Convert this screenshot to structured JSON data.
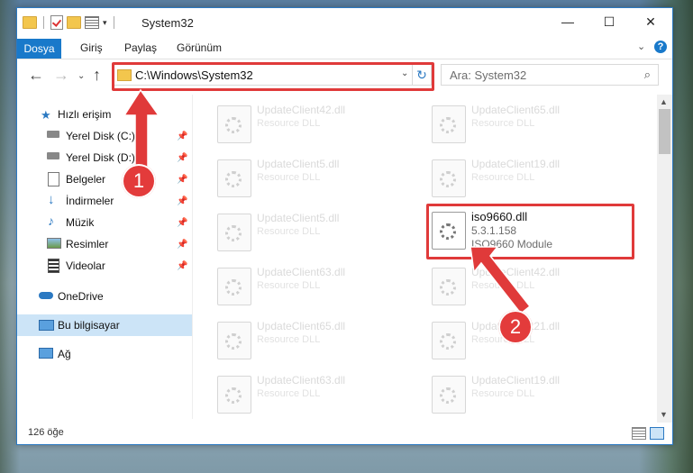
{
  "window": {
    "title": "System32",
    "controls": {
      "minimize": "—",
      "maximize": "☐",
      "close": "✕"
    }
  },
  "ribbon": {
    "tabs": [
      "Dosya",
      "Giriş",
      "Paylaş",
      "Görünüm"
    ]
  },
  "nav": {
    "address": "C:\\Windows\\System32",
    "search_placeholder": "Ara: System32"
  },
  "sidebar": {
    "items": [
      {
        "label": "Hızlı erişim",
        "icon": "star-icon",
        "pinned": false
      },
      {
        "label": "Yerel Disk (C:)",
        "icon": "drive-icon",
        "pinned": true
      },
      {
        "label": "Yerel Disk (D:)",
        "icon": "drive-icon",
        "pinned": true
      },
      {
        "label": "Belgeler",
        "icon": "document-icon",
        "pinned": true
      },
      {
        "label": "İndirmeler",
        "icon": "download-icon",
        "pinned": true
      },
      {
        "label": "Müzik",
        "icon": "music-icon",
        "pinned": true
      },
      {
        "label": "Resimler",
        "icon": "pictures-icon",
        "pinned": true
      },
      {
        "label": "Videolar",
        "icon": "video-icon",
        "pinned": true
      },
      {
        "label": "OneDrive",
        "icon": "cloud-icon",
        "pinned": false
      },
      {
        "label": "Bu bilgisayar",
        "icon": "computer-icon",
        "pinned": false,
        "selected": true
      },
      {
        "label": "Ağ",
        "icon": "network-icon",
        "pinned": false
      }
    ]
  },
  "files": {
    "left": [
      {
        "name": "UpdateClient42.dll",
        "type": "Resource DLL"
      },
      {
        "name": "UpdateClient5.dll",
        "type": "Resource DLL"
      },
      {
        "name": "UpdateClient5.dll",
        "type": "Resource DLL"
      },
      {
        "name": "UpdateClient63.dll",
        "type": "Resource DLL"
      },
      {
        "name": "UpdateClient65.dll",
        "type": "Resource DLL"
      },
      {
        "name": "UpdateClient63.dll",
        "type": "Resource DLL"
      }
    ],
    "right": [
      {
        "name": "UpdateClient65.dll",
        "type": "Resource DLL"
      },
      {
        "name": "UpdateClient19.dll",
        "type": "Resource DLL"
      },
      {
        "name": "iso9660.dll",
        "version": "5.3.1.158",
        "type": "ISO9660 Module",
        "active": true
      },
      {
        "name": "UpdateClient42.dll",
        "type": "Resource DLL"
      },
      {
        "name": "UpdateClient21.dll",
        "type": "Resource DLL"
      },
      {
        "name": "UpdateClient19.dll",
        "type": "Resource DLL"
      }
    ]
  },
  "status": {
    "count": "126 öğe"
  },
  "annotations": {
    "step1": "1",
    "step2": "2",
    "color": "#e03a3a"
  }
}
